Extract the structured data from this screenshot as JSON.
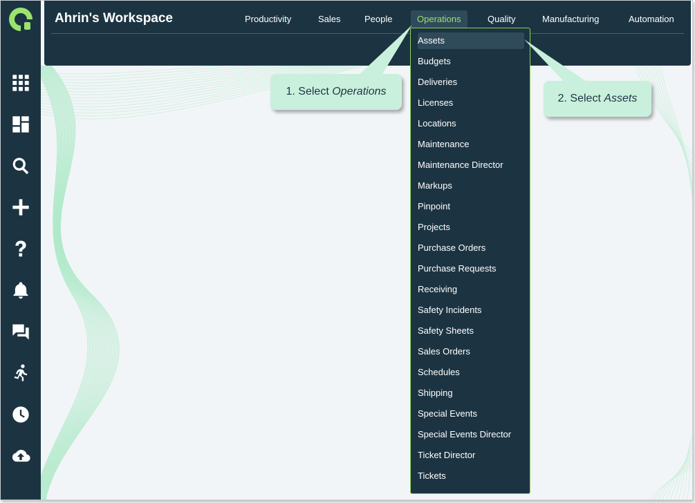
{
  "app": {
    "workspace_title": "Ahrin's Workspace"
  },
  "nav": {
    "items": [
      {
        "label": "Productivity"
      },
      {
        "label": "Sales"
      },
      {
        "label": "People"
      },
      {
        "label": "Operations"
      },
      {
        "label": "Quality"
      },
      {
        "label": "Manufacturing"
      },
      {
        "label": "Automation"
      }
    ],
    "active": "Operations"
  },
  "dropdown": {
    "items": [
      "Assets",
      "Budgets",
      "Deliveries",
      "Licenses",
      "Locations",
      "Maintenance",
      "Maintenance Director",
      "Markups",
      "Pinpoint",
      "Projects",
      "Purchase Orders",
      "Purchase Requests",
      "Receiving",
      "Safety Incidents",
      "Safety Sheets",
      "Sales Orders",
      "Schedules",
      "Shipping",
      "Special Events",
      "Special Events Director",
      "Ticket Director",
      "Tickets"
    ],
    "highlighted": "Assets"
  },
  "callouts": {
    "step1": {
      "prefix": "1. Select ",
      "target": "Operations"
    },
    "step2": {
      "prefix": "2. Select ",
      "target": "Assets"
    }
  },
  "sidebar": {
    "icons": [
      "apps-grid-icon",
      "dashboard-icon",
      "search-icon",
      "add-icon",
      "help-icon",
      "bell-icon",
      "chat-icon",
      "run-icon",
      "clock-icon",
      "cloud-upload-icon"
    ]
  },
  "colors": {
    "navy": "#1c3442",
    "accent_green": "#9be36f",
    "callout_bg": "#c9f0dc",
    "background": "#f2f5f7"
  }
}
